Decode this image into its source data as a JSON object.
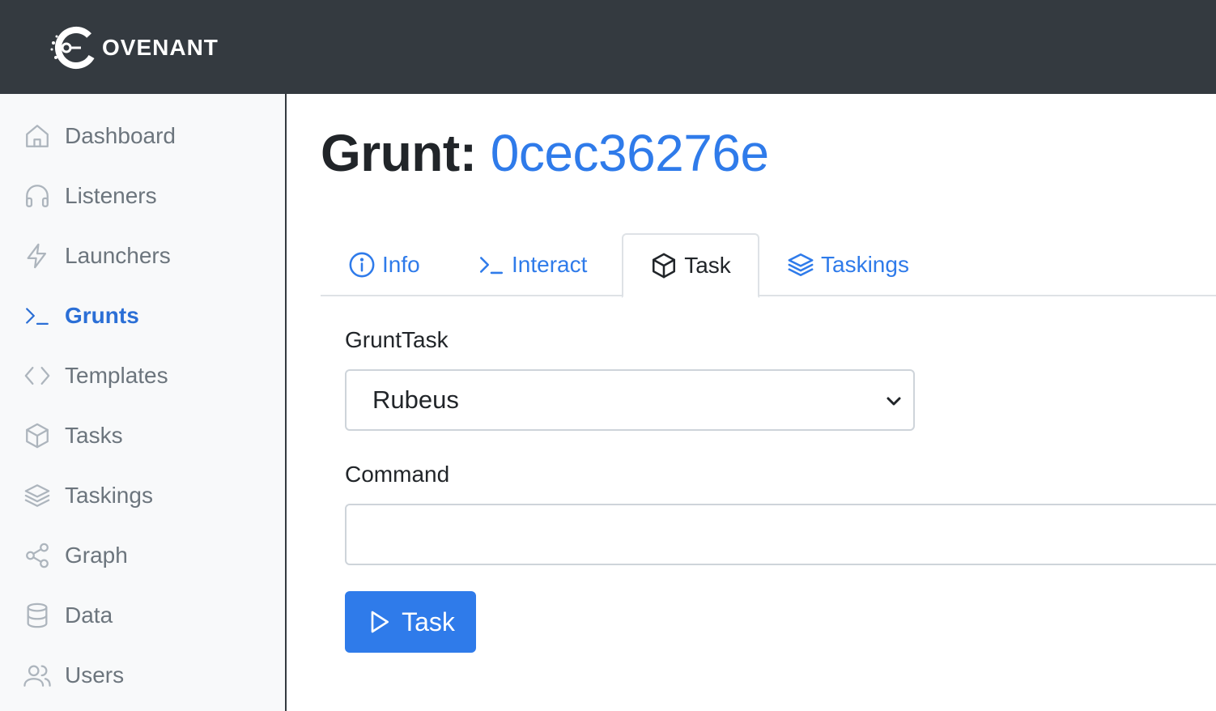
{
  "app": {
    "brand": "OVENANT"
  },
  "sidebar": {
    "items": [
      {
        "label": "Dashboard",
        "icon": "house-icon"
      },
      {
        "label": "Listeners",
        "icon": "headphones-icon"
      },
      {
        "label": "Launchers",
        "icon": "lightning-icon"
      },
      {
        "label": "Grunts",
        "icon": "terminal-icon",
        "active": true
      },
      {
        "label": "Templates",
        "icon": "code-icon"
      },
      {
        "label": "Tasks",
        "icon": "box-icon"
      },
      {
        "label": "Taskings",
        "icon": "layers-icon"
      },
      {
        "label": "Graph",
        "icon": "share-icon"
      },
      {
        "label": "Data",
        "icon": "database-icon"
      },
      {
        "label": "Users",
        "icon": "people-icon"
      }
    ]
  },
  "page": {
    "title_prefix": "Grunt:",
    "grunt_id": "0cec36276e"
  },
  "tabs": [
    {
      "label": "Info",
      "icon": "info-circle-icon"
    },
    {
      "label": "Interact",
      "icon": "terminal-icon"
    },
    {
      "label": "Task",
      "icon": "box-icon",
      "active": true
    },
    {
      "label": "Taskings",
      "icon": "layers-icon"
    }
  ],
  "form": {
    "grunttask_label": "GruntTask",
    "grunttask_value": "Rubeus",
    "command_label": "Command",
    "command_value": "",
    "submit_label": "Task"
  },
  "colors": {
    "topbar": "#343a40",
    "accent": "#2f7bea",
    "sidebar_bg": "#f8f9fa"
  }
}
